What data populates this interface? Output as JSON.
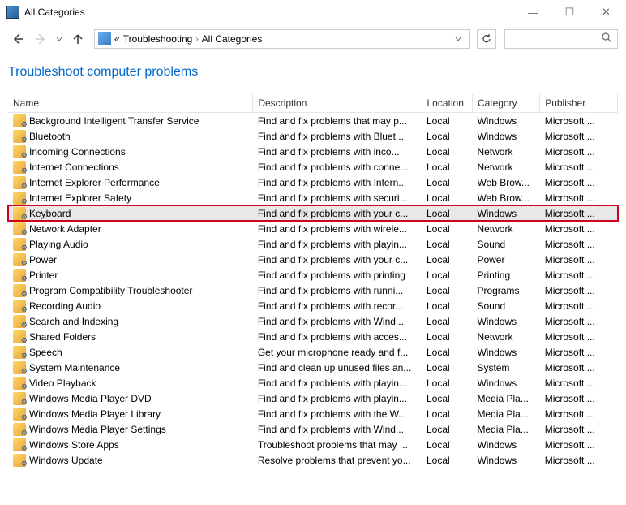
{
  "window": {
    "title": "All Categories"
  },
  "breadcrumb": {
    "root_marker": "«",
    "item1": "Troubleshooting",
    "item2": "All Categories"
  },
  "heading": "Troubleshoot computer problems",
  "columns": {
    "name": "Name",
    "description": "Description",
    "location": "Location",
    "category": "Category",
    "publisher": "Publisher"
  },
  "rows": [
    {
      "name": "Background Intelligent Transfer Service",
      "description": "Find and fix problems that may p...",
      "location": "Local",
      "category": "Windows",
      "publisher": "Microsoft ...",
      "highlighted": false
    },
    {
      "name": "Bluetooth",
      "description": "Find and fix problems with Bluet...",
      "location": "Local",
      "category": "Windows",
      "publisher": "Microsoft ...",
      "highlighted": false
    },
    {
      "name": "Incoming Connections",
      "description": "Find and fix problems with inco...",
      "location": "Local",
      "category": "Network",
      "publisher": "Microsoft ...",
      "highlighted": false
    },
    {
      "name": "Internet Connections",
      "description": "Find and fix problems with conne...",
      "location": "Local",
      "category": "Network",
      "publisher": "Microsoft ...",
      "highlighted": false
    },
    {
      "name": "Internet Explorer Performance",
      "description": "Find and fix problems with Intern...",
      "location": "Local",
      "category": "Web Brow...",
      "publisher": "Microsoft ...",
      "highlighted": false
    },
    {
      "name": "Internet Explorer Safety",
      "description": "Find and fix problems with securi...",
      "location": "Local",
      "category": "Web Brow...",
      "publisher": "Microsoft ...",
      "highlighted": false
    },
    {
      "name": "Keyboard",
      "description": "Find and fix problems with your c...",
      "location": "Local",
      "category": "Windows",
      "publisher": "Microsoft ...",
      "highlighted": true
    },
    {
      "name": "Network Adapter",
      "description": "Find and fix problems with wirele...",
      "location": "Local",
      "category": "Network",
      "publisher": "Microsoft ...",
      "highlighted": false
    },
    {
      "name": "Playing Audio",
      "description": "Find and fix problems with playin...",
      "location": "Local",
      "category": "Sound",
      "publisher": "Microsoft ...",
      "highlighted": false
    },
    {
      "name": "Power",
      "description": "Find and fix problems with your c...",
      "location": "Local",
      "category": "Power",
      "publisher": "Microsoft ...",
      "highlighted": false
    },
    {
      "name": "Printer",
      "description": "Find and fix problems with printing",
      "location": "Local",
      "category": "Printing",
      "publisher": "Microsoft ...",
      "highlighted": false
    },
    {
      "name": "Program Compatibility Troubleshooter",
      "description": "Find and fix problems with runni...",
      "location": "Local",
      "category": "Programs",
      "publisher": "Microsoft ...",
      "highlighted": false
    },
    {
      "name": "Recording Audio",
      "description": "Find and fix problems with recor...",
      "location": "Local",
      "category": "Sound",
      "publisher": "Microsoft ...",
      "highlighted": false
    },
    {
      "name": "Search and Indexing",
      "description": "Find and fix problems with Wind...",
      "location": "Local",
      "category": "Windows",
      "publisher": "Microsoft ...",
      "highlighted": false
    },
    {
      "name": "Shared Folders",
      "description": "Find and fix problems with acces...",
      "location": "Local",
      "category": "Network",
      "publisher": "Microsoft ...",
      "highlighted": false
    },
    {
      "name": "Speech",
      "description": "Get your microphone ready and f...",
      "location": "Local",
      "category": "Windows",
      "publisher": "Microsoft ...",
      "highlighted": false
    },
    {
      "name": "System Maintenance",
      "description": "Find and clean up unused files an...",
      "location": "Local",
      "category": "System",
      "publisher": "Microsoft ...",
      "highlighted": false
    },
    {
      "name": "Video Playback",
      "description": "Find and fix problems with playin...",
      "location": "Local",
      "category": "Windows",
      "publisher": "Microsoft ...",
      "highlighted": false
    },
    {
      "name": "Windows Media Player DVD",
      "description": "Find and fix problems with playin...",
      "location": "Local",
      "category": "Media Pla...",
      "publisher": "Microsoft ...",
      "highlighted": false
    },
    {
      "name": "Windows Media Player Library",
      "description": "Find and fix problems with the W...",
      "location": "Local",
      "category": "Media Pla...",
      "publisher": "Microsoft ...",
      "highlighted": false
    },
    {
      "name": "Windows Media Player Settings",
      "description": "Find and fix problems with Wind...",
      "location": "Local",
      "category": "Media Pla...",
      "publisher": "Microsoft ...",
      "highlighted": false
    },
    {
      "name": "Windows Store Apps",
      "description": "Troubleshoot problems that may ...",
      "location": "Local",
      "category": "Windows",
      "publisher": "Microsoft ...",
      "highlighted": false
    },
    {
      "name": "Windows Update",
      "description": "Resolve problems that prevent yo...",
      "location": "Local",
      "category": "Windows",
      "publisher": "Microsoft ...",
      "highlighted": false
    }
  ]
}
